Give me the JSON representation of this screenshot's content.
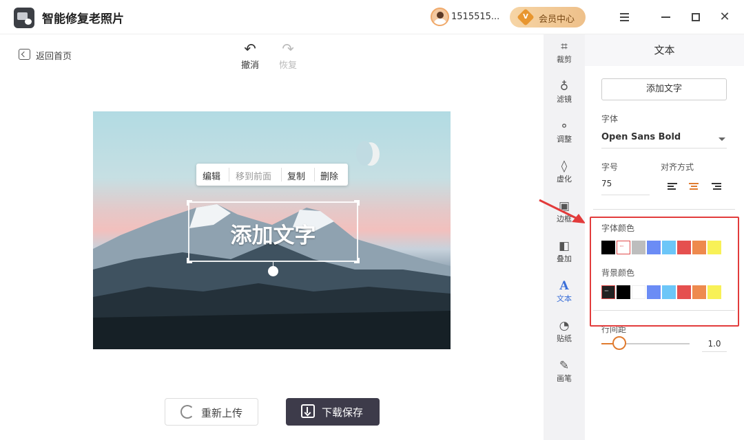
{
  "app": {
    "title": "智能修复老照片",
    "username": "1515515...",
    "vip_label": "会员中心",
    "vip_badge": "V"
  },
  "toolbar": {
    "back_label": "返回首页",
    "undo_label": "撤消",
    "redo_label": "恢复"
  },
  "context_menu": {
    "edit": "编辑",
    "bring_front": "移到前面",
    "copy": "复制",
    "delete": "删除"
  },
  "canvas": {
    "text_overlay": "添加文字"
  },
  "actions": {
    "reupload": "重新上传",
    "download": "下载保存"
  },
  "sidebar": {
    "items": [
      {
        "label": "裁剪",
        "icon": "crop-icon"
      },
      {
        "label": "滤镜",
        "icon": "filter-icon"
      },
      {
        "label": "调整",
        "icon": "adjust-icon"
      },
      {
        "label": "虚化",
        "icon": "blur-icon"
      },
      {
        "label": "边框",
        "icon": "border-icon"
      },
      {
        "label": "叠加",
        "icon": "overlay-icon"
      },
      {
        "label": "文本",
        "icon": "text-icon",
        "active": true
      },
      {
        "label": "贴纸",
        "icon": "sticker-icon"
      },
      {
        "label": "画笔",
        "icon": "brush-icon"
      }
    ]
  },
  "panel": {
    "title": "文本",
    "add_text_button": "添加文字",
    "font_label": "字体",
    "font_value": "Open Sans Bold",
    "size_label": "字号",
    "size_value": "75",
    "align_label": "对齐方式",
    "align_selected": "center",
    "font_color_label": "字体颜色",
    "font_colors": [
      "#000000",
      "picker",
      "#bdbdbd",
      "#6b8cf5",
      "#6cc6f8",
      "#e5504f",
      "#ee8a4e",
      "#f8f157"
    ],
    "bg_color_label": "背景颜色",
    "bg_colors": [
      "picker",
      "#000000",
      "#ffffff",
      "#6b8cf5",
      "#6cc6f8",
      "#e5504f",
      "#ee8a4e",
      "#f8f157"
    ],
    "line_spacing_label": "行间距",
    "line_spacing_value": "1.0"
  },
  "colors": {
    "accent": "#e07a2e",
    "active_blue": "#3a6fd8",
    "highlight_red": "#e23b3b",
    "download_btn": "#3d3b4a"
  }
}
